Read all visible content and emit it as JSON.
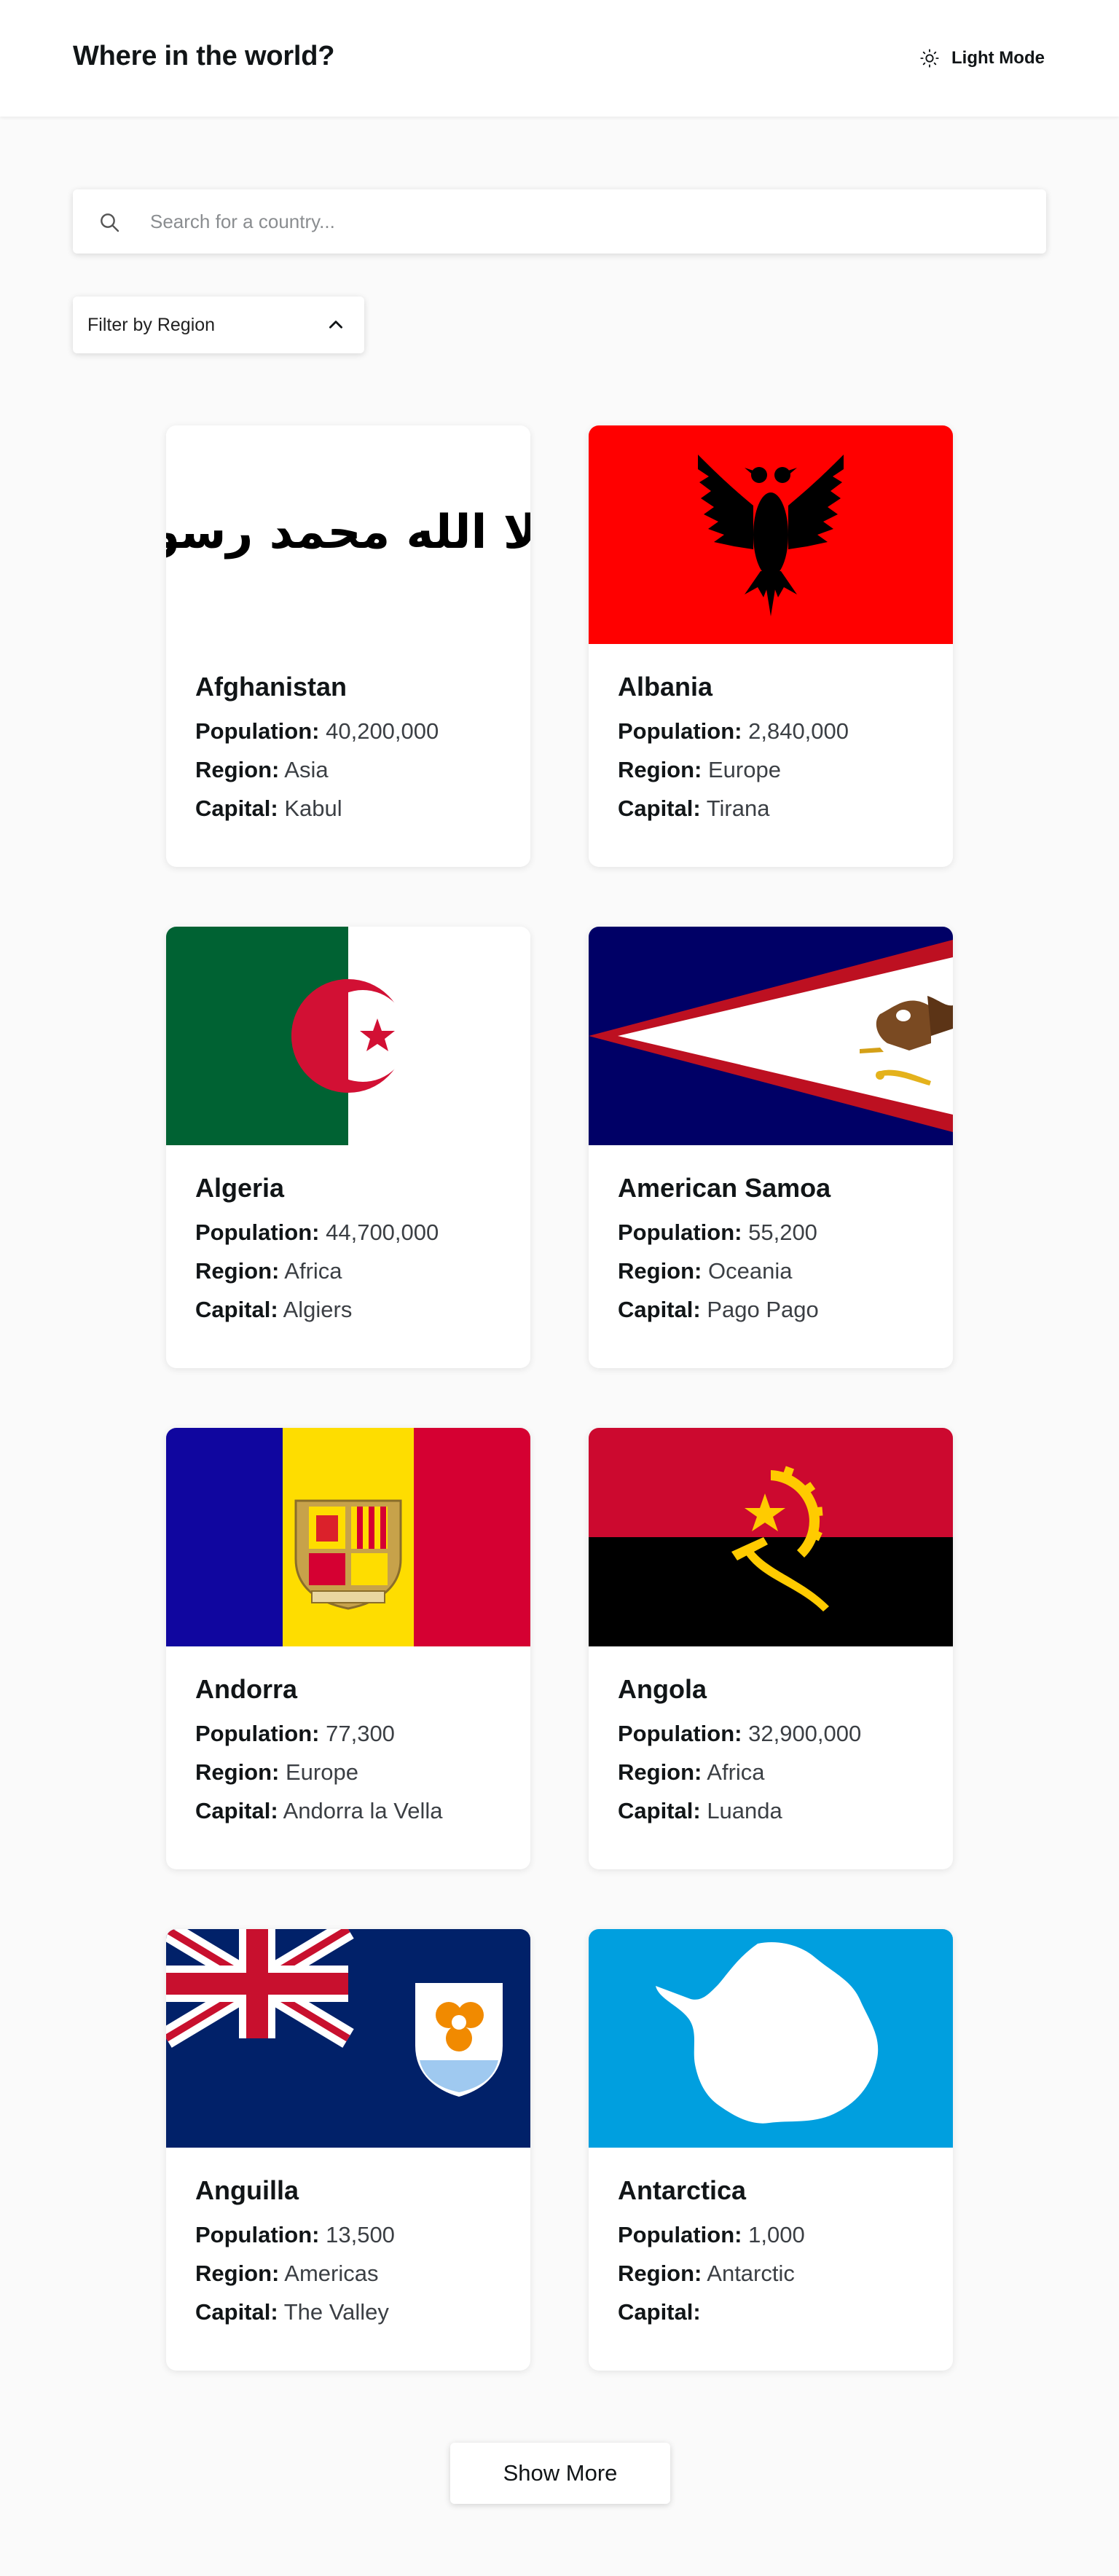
{
  "header": {
    "title": "Where in the world?",
    "theme_label": "Light Mode",
    "theme_icon": "sun-icon"
  },
  "search": {
    "placeholder": "Search for a country...",
    "value": "",
    "icon": "search-icon"
  },
  "filter": {
    "label": "Filter by Region",
    "icon": "chevron-up-icon"
  },
  "field_labels": {
    "population": "Population:",
    "region": "Region:",
    "capital": "Capital:"
  },
  "countries": [
    {
      "name": "Afghanistan",
      "population": "40,200,000",
      "region": "Asia",
      "capital": "Kabul",
      "flag": "afghanistan-flag",
      "flag_text": "لا إله إلا الله محمد رسول الله"
    },
    {
      "name": "Albania",
      "population": "2,840,000",
      "region": "Europe",
      "capital": "Tirana",
      "flag": "albania-flag"
    },
    {
      "name": "Algeria",
      "population": "44,700,000",
      "region": "Africa",
      "capital": "Algiers",
      "flag": "algeria-flag"
    },
    {
      "name": "American Samoa",
      "population": "55,200",
      "region": "Oceania",
      "capital": "Pago Pago",
      "flag": "american-samoa-flag"
    },
    {
      "name": "Andorra",
      "population": "77,300",
      "region": "Europe",
      "capital": "Andorra la Vella",
      "flag": "andorra-flag"
    },
    {
      "name": "Angola",
      "population": "32,900,000",
      "region": "Africa",
      "capital": "Luanda",
      "flag": "angola-flag"
    },
    {
      "name": "Anguilla",
      "population": "13,500",
      "region": "Americas",
      "capital": "The Valley",
      "flag": "anguilla-flag"
    },
    {
      "name": "Antarctica",
      "population": "1,000",
      "region": "Antarctic",
      "capital": "",
      "flag": "antarctica-flag"
    }
  ],
  "show_more_label": "Show More",
  "colors": {
    "background": "#fafafa",
    "card": "#ffffff",
    "text": "#111517"
  }
}
